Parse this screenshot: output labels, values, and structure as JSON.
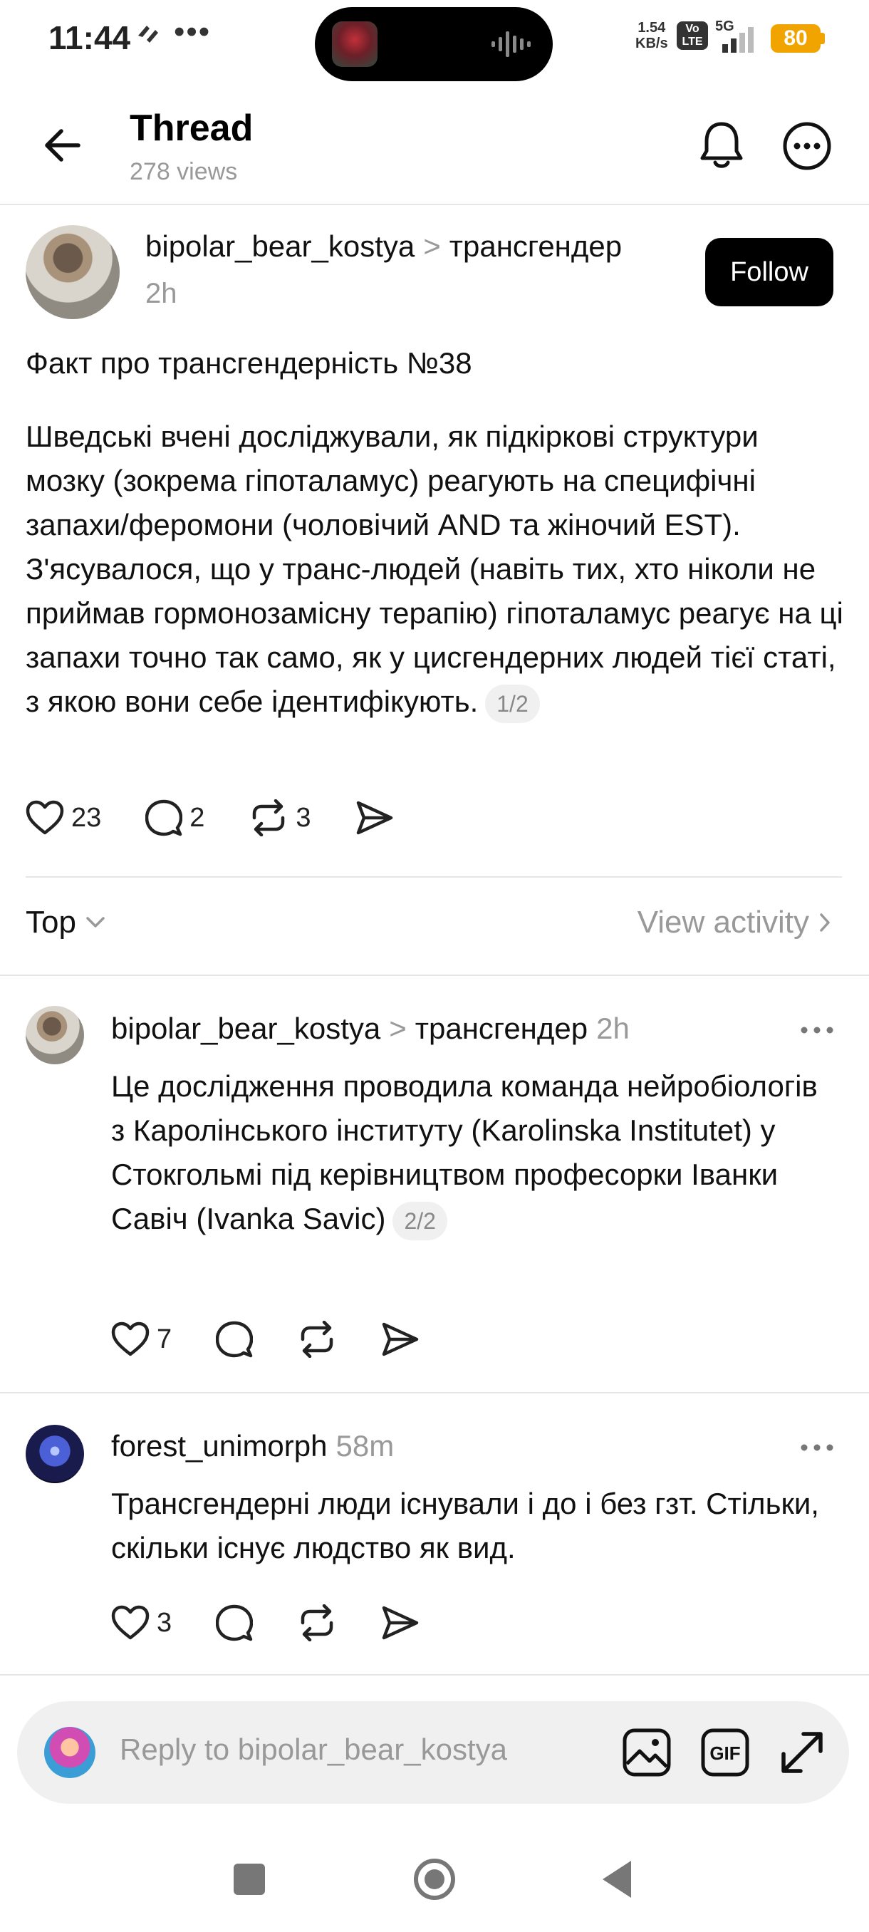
{
  "status_bar": {
    "time": "11:44",
    "dots": "•••",
    "speed_value": "1.54",
    "speed_unit": "KB/s",
    "volte": "Vo LTE",
    "network": "5G",
    "battery": "80"
  },
  "header": {
    "title": "Thread",
    "views": "278 views"
  },
  "post": {
    "username": "bipolar_bear_kostya",
    "separator": ">",
    "community": "трансгендер",
    "time": "2h",
    "follow_label": "Follow",
    "heading": "Факт про трансгендерність №38",
    "body": "Шведські вчені досліджували, як підкіркові структури мозку (зокрема гіпоталамус) реагують на специфічні запахи/феромони (чоловічий AND та жіночий EST). З'ясувалося, що у транс-людей (навіть тих, хто ніколи не приймав гормонозамісну терапію) гіпоталамус реагує на ці запахи точно так само, як у цисгендерних людей тієї статі, з якою вони себе ідентифікують.",
    "page_pill": "1/2",
    "likes": "23",
    "replies": "2",
    "reposts": "3"
  },
  "sort": {
    "label": "Top",
    "view_activity": "View activity"
  },
  "replies": [
    {
      "username": "bipolar_bear_kostya",
      "separator": ">",
      "community": "трансгендер",
      "time": "2h",
      "body": "Це дослідження проводила команда нейробіологів з Каролінського інституту (Karolinska Institutet) у Стокгольмі під керівництвом професорки Іванки Савіч (Ivanka Savic)",
      "page_pill": "2/2",
      "likes": "7"
    },
    {
      "username": "forest_unimorph",
      "time": "58m",
      "body": "Трансгендерні люди існували і до і без гзт. Стільки, скільки існує людство як вид.",
      "likes": "3"
    }
  ],
  "reply_bar": {
    "placeholder": "Reply to bipolar_bear_kostya"
  },
  "icons": {
    "back": "arrow-left-icon",
    "notifications": "bell-icon",
    "more": "more-circle-icon",
    "like": "heart-icon",
    "reply": "comment-icon",
    "repost": "repost-icon",
    "share": "send-icon",
    "image": "image-icon",
    "gif": "gif-icon",
    "expand": "expand-icon"
  }
}
